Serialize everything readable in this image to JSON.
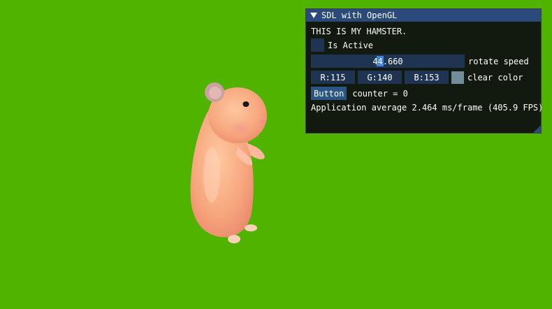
{
  "scene": {
    "background_color": "#4fb300",
    "model_icon": "hamster-3d-model"
  },
  "window": {
    "title": "SDL with OpenGL",
    "text": "THIS IS MY HAMSTER.",
    "checkbox_label": "Is Active",
    "checkbox_checked": false,
    "slider": {
      "value": "44.660",
      "label": "rotate speed"
    },
    "color": {
      "r": "R:115",
      "g": "G:140",
      "b": "B:153",
      "swatch": "#738c99",
      "label": "clear color"
    },
    "button_label": "Button",
    "counter_text": "counter = 0",
    "stats": "Application average 2.464 ms/frame (405.9 FPS)",
    "colors": {
      "title_bar": "#294a7a",
      "frame_bg": "#1f3453",
      "button": "#2a5585",
      "slider_grab": "#3d85e0"
    }
  }
}
